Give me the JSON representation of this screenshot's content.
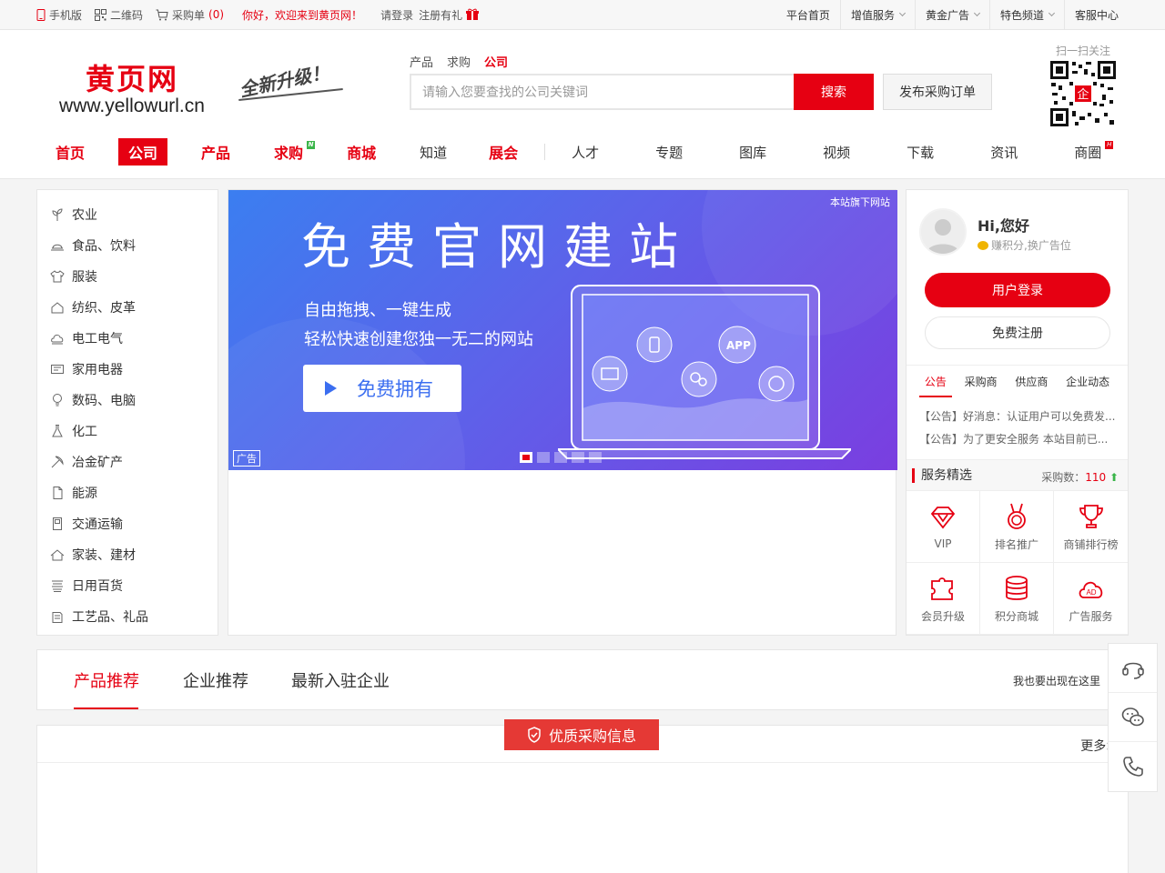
{
  "topbar": {
    "mobile": "手机版",
    "qrcode": "二维码",
    "cart": "采购单",
    "cart_count": "(0)",
    "welcome": "你好，欢迎来到黄页网！",
    "login": "请登录",
    "register": "注册有礼",
    "right": [
      "平台首页",
      "增值服务",
      "黄金广告",
      "特色频道",
      "客服中心"
    ]
  },
  "header": {
    "logo_cn": "黄页网",
    "logo_en": "www.yellowurl.cn",
    "slogan": "全新升级！",
    "search_tabs": [
      "产品",
      "求购",
      "公司"
    ],
    "search_placeholder": "请输入您要查找的公司关键词",
    "search_btn": "搜索",
    "publish_btn": "发布采购订单",
    "qr_label": "扫一扫关注",
    "qr_center": "企"
  },
  "nav": [
    "首页",
    "公司",
    "产品",
    "求购",
    "商城",
    "知道",
    "展会",
    "人才",
    "专题",
    "图库",
    "视频",
    "下载",
    "资讯",
    "商圈"
  ],
  "nav_badges": {
    "new": "N",
    "hot": "H"
  },
  "categories": [
    {
      "label": "农业",
      "icon": "plant-icon"
    },
    {
      "label": "食品、饮料",
      "icon": "food-icon"
    },
    {
      "label": "服装",
      "icon": "clothing-icon"
    },
    {
      "label": "纺织、皮革",
      "icon": "textile-icon"
    },
    {
      "label": "电工电气",
      "icon": "electric-icon"
    },
    {
      "label": "家用电器",
      "icon": "appliance-icon"
    },
    {
      "label": "数码、电脑",
      "icon": "digital-icon"
    },
    {
      "label": "化工",
      "icon": "chemical-icon"
    },
    {
      "label": "冶金矿产",
      "icon": "mining-icon"
    },
    {
      "label": "能源",
      "icon": "energy-icon"
    },
    {
      "label": "交通运输",
      "icon": "transport-icon"
    },
    {
      "label": "家装、建材",
      "icon": "building-icon"
    },
    {
      "label": "日用百货",
      "icon": "daily-icon"
    },
    {
      "label": "工艺品、礼品",
      "icon": "gift-icon"
    }
  ],
  "banner": {
    "headline": "免费官网建站",
    "line1": "自由拖拽、一键生成",
    "line2": "轻松快速创建您独一无二的网站",
    "cta": "免费拥有",
    "site_tag": "本站旗下网站",
    "ad_tag": "广告",
    "app_label": "APP",
    "slide_count": 5,
    "active_slide": 1
  },
  "user": {
    "greeting": "Hi,您好",
    "earn": "赚积分,换广告位",
    "login_btn": "用户登录",
    "register_btn": "免费注册",
    "tabs": [
      "公告",
      "采购商",
      "供应商",
      "企业动态"
    ],
    "notices": [
      "【公告】好消息：认证用户可以免费发...",
      "【公告】为了更安全服务 本站目前已..."
    ],
    "service_title": "服务精选",
    "purchase_label": "采购数：",
    "purchase_count": "110",
    "services": [
      {
        "label": "VIP",
        "icon": "diamond-icon"
      },
      {
        "label": "排名推广",
        "icon": "medal-icon"
      },
      {
        "label": "商铺排行榜",
        "icon": "trophy-icon"
      },
      {
        "label": "会员升级",
        "icon": "puzzle-icon"
      },
      {
        "label": "积分商城",
        "icon": "coins-icon"
      },
      {
        "label": "广告服务",
        "icon": "ad-cloud-icon"
      }
    ]
  },
  "section": {
    "tabs": [
      "产品推荐",
      "企业推荐",
      "最新入驻企业"
    ],
    "right": "我也要出现在这里"
  },
  "purchase": {
    "title": "优质采购信息",
    "more": "更多>"
  },
  "colors": {
    "brand": "#e60012",
    "banner_start": "#3b7ef0",
    "banner_end": "#7a3ee0"
  }
}
